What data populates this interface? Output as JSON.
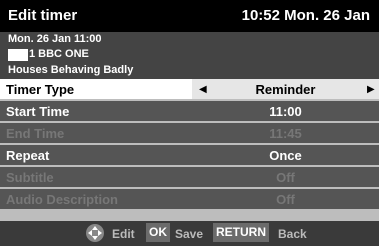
{
  "header": {
    "title": "Edit timer",
    "clock": "10:52 Mon. 26 Jan"
  },
  "programme": {
    "datetime": "Mon. 26 Jan 11:00",
    "channel": "1 BBC ONE",
    "name": "Houses Behaving Badly"
  },
  "rows": [
    {
      "label": "Timer Type",
      "value": "Reminder",
      "selected": true,
      "enabled": true
    },
    {
      "label": "Start Time",
      "value": "11:00",
      "enabled": true
    },
    {
      "label": "End Time",
      "value": "11:45",
      "enabled": false
    },
    {
      "label": "Repeat",
      "value": "Once",
      "enabled": true
    },
    {
      "label": "Subtitle",
      "value": "Off",
      "enabled": false
    },
    {
      "label": "Audio Description",
      "value": "Off",
      "enabled": false
    }
  ],
  "footer": {
    "edit_label": "Edit",
    "ok_key": "OK",
    "save_label": "Save",
    "return_key": "RETURN",
    "back_label": "Back"
  },
  "icons": {
    "left": "arrow-left-icon",
    "right": "arrow-right-icon",
    "dpad": "dpad-icon"
  }
}
